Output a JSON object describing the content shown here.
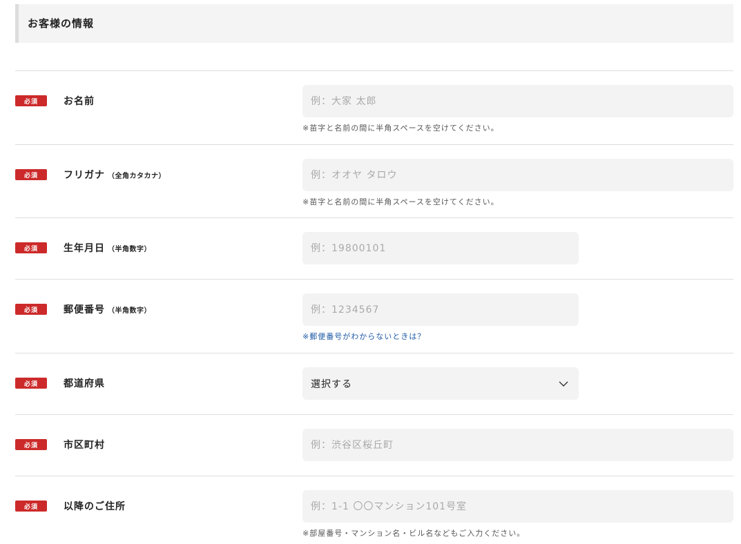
{
  "section": {
    "title": "お客様の情報"
  },
  "required_badge": "必須",
  "fields": {
    "name": {
      "label": "お名前",
      "note": "",
      "placeholder": "例：大家 太郎",
      "hint": "※苗字と名前の間に半角スペースを空けてください。"
    },
    "furigana": {
      "label": "フリガナ",
      "note": "（全角カタカナ）",
      "placeholder": "例：オオヤ タロウ",
      "hint": "※苗字と名前の間に半角スペースを空けてください。"
    },
    "birthdate": {
      "label": "生年月日",
      "note": "（半角数字）",
      "placeholder": "例：19800101"
    },
    "postal": {
      "label": "郵便番号",
      "note": "（半角数字）",
      "placeholder": "例：1234567",
      "hint_link": "※郵便番号がわからないときは？"
    },
    "prefecture": {
      "label": "都道府県",
      "selected": "選択する",
      "icon": "chevron-down-icon"
    },
    "city": {
      "label": "市区町村",
      "placeholder": "例：渋谷区桜丘町"
    },
    "address": {
      "label": "以降のご住所",
      "placeholder": "例：1-1 〇〇マンション101号室",
      "hint": "※部屋番号・マンション名・ビル名などもご入力ください。"
    }
  },
  "colors": {
    "badge": "#cc2a2a",
    "field_bg": "#f3f3f3",
    "link": "#1f5aa6"
  }
}
